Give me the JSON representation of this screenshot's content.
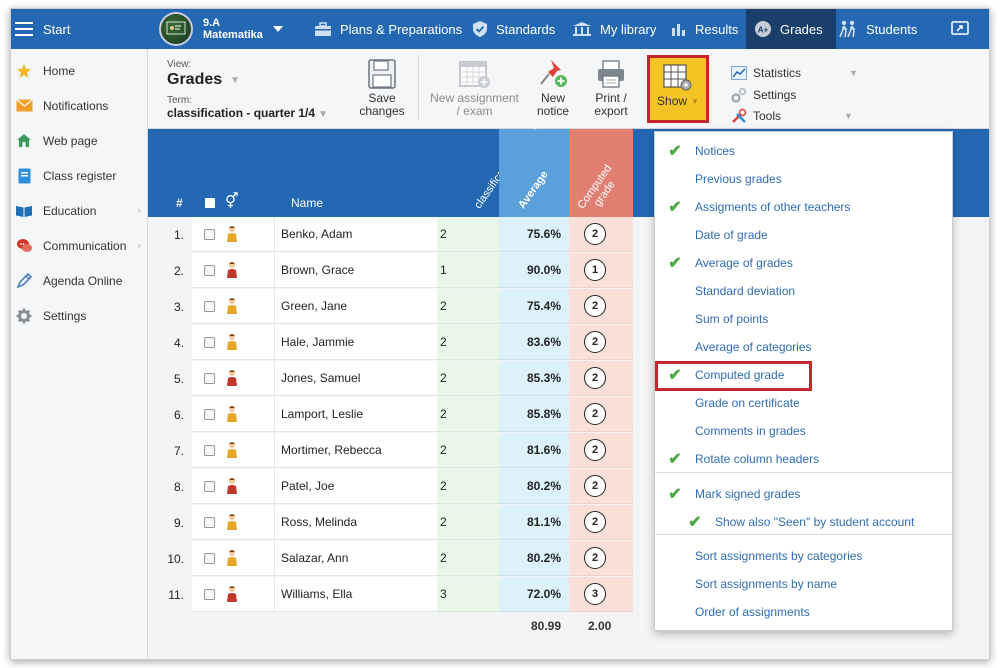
{
  "topbar": {
    "start_label": "Start",
    "class_name": "9.A",
    "subject": "Matematika",
    "nav": [
      {
        "label": "Plans & Preparations",
        "icon": "briefcase-icon"
      },
      {
        "label": "Standards",
        "icon": "shield-check-icon"
      },
      {
        "label": "My library",
        "icon": "library-icon"
      },
      {
        "label": "Results",
        "icon": "bar-chart-icon"
      },
      {
        "label": "Grades",
        "icon": "grades-icon"
      },
      {
        "label": "Students",
        "icon": "students-icon"
      }
    ]
  },
  "sidebar": {
    "items": [
      {
        "label": "Home",
        "icon": "star-icon"
      },
      {
        "label": "Notifications",
        "icon": "envelope-icon"
      },
      {
        "label": "Web page",
        "icon": "house-icon"
      },
      {
        "label": "Class register",
        "icon": "register-icon"
      },
      {
        "label": "Education",
        "icon": "book-icon"
      },
      {
        "label": "Communication",
        "icon": "chat-icon"
      },
      {
        "label": "Agenda Online",
        "icon": "pen-icon"
      },
      {
        "label": "Settings",
        "icon": "gear-icon"
      }
    ]
  },
  "toolbar": {
    "view_label": "View:",
    "view_value": "Grades",
    "term_label": "Term:",
    "term_value": "classification - quarter 1/4",
    "save_line1": "Save",
    "save_line2": "changes",
    "new_assign_line1": "New assignment",
    "new_assign_line2": "/ exam",
    "new_notice_line1": "New",
    "new_notice_line2": "notice",
    "print_line1": "Print /",
    "print_line2": "export",
    "show_label": "Show",
    "statistics": "Statistics",
    "settings": "Settings",
    "tools": "Tools"
  },
  "grid": {
    "header": {
      "num": "#",
      "name": "Name",
      "col_classification": "classification - quar...",
      "col_average": "Average",
      "col_computed": "Computed grade"
    },
    "rows": [
      {
        "num": "1.",
        "name": "Benko, Adam",
        "grade": "2",
        "average": "75.6%",
        "computed": "2",
        "gender": "male"
      },
      {
        "num": "2.",
        "name": "Brown, Grace",
        "grade": "1",
        "average": "90.0%",
        "computed": "1",
        "gender": "female"
      },
      {
        "num": "3.",
        "name": "Green, Jane",
        "grade": "2",
        "average": "75.4%",
        "computed": "2",
        "gender": "male"
      },
      {
        "num": "4.",
        "name": "Hale, Jammie",
        "grade": "2",
        "average": "83.6%",
        "computed": "2",
        "gender": "male"
      },
      {
        "num": "5.",
        "name": "Jones, Samuel",
        "grade": "2",
        "average": "85.3%",
        "computed": "2",
        "gender": "female"
      },
      {
        "num": "6.",
        "name": "Lamport, Leslie",
        "grade": "2",
        "average": "85.8%",
        "computed": "2",
        "gender": "male"
      },
      {
        "num": "7.",
        "name": "Mortimer, Rebecca",
        "grade": "2",
        "average": "81.6%",
        "computed": "2",
        "gender": "male"
      },
      {
        "num": "8.",
        "name": "Patel, Joe",
        "grade": "2",
        "average": "80.2%",
        "computed": "2",
        "gender": "female"
      },
      {
        "num": "9.",
        "name": "Ross, Melinda",
        "grade": "2",
        "average": "81.1%",
        "computed": "2",
        "gender": "male"
      },
      {
        "num": "10.",
        "name": "Salazar, Ann",
        "grade": "2",
        "average": "80.2%",
        "computed": "2",
        "gender": "male"
      },
      {
        "num": "11.",
        "name": "Williams, Ella",
        "grade": "3",
        "average": "72.0%",
        "computed": "3",
        "gender": "female"
      }
    ],
    "footer_average": "80.99",
    "footer_computed": "2.00"
  },
  "show_menu": {
    "items": [
      {
        "label": "Notices",
        "checked": true
      },
      {
        "label": "Previous grades",
        "checked": false
      },
      {
        "label": "Assigments of other teachers",
        "checked": true
      },
      {
        "label": "Date of grade",
        "checked": false
      },
      {
        "label": "Average of grades",
        "checked": true
      },
      {
        "label": "Standard deviation",
        "checked": false
      },
      {
        "label": "Sum of points",
        "checked": false
      },
      {
        "label": "Average of categories",
        "checked": false
      },
      {
        "label": "Computed grade",
        "checked": true
      },
      {
        "label": "Grade on certificate",
        "checked": false
      },
      {
        "label": "Comments in grades",
        "checked": false
      },
      {
        "label": "Rotate column headers",
        "checked": true
      },
      {
        "label": "Mark signed grades",
        "checked": true
      },
      {
        "label": "Show also \"Seen\" by student account",
        "checked": true
      },
      {
        "label": "Sort assignments by categories",
        "checked": false
      },
      {
        "label": "Sort assignments by name",
        "checked": false
      },
      {
        "label": "Order of assignments",
        "checked": false
      }
    ]
  },
  "colors": {
    "nav_blue": "#2467b3",
    "nav_active": "#1a3f6a",
    "show_yellow": "#f4c425",
    "highlight_red": "#c2272d",
    "check_green": "#4ca847",
    "link_blue": "#2e6cb4"
  }
}
